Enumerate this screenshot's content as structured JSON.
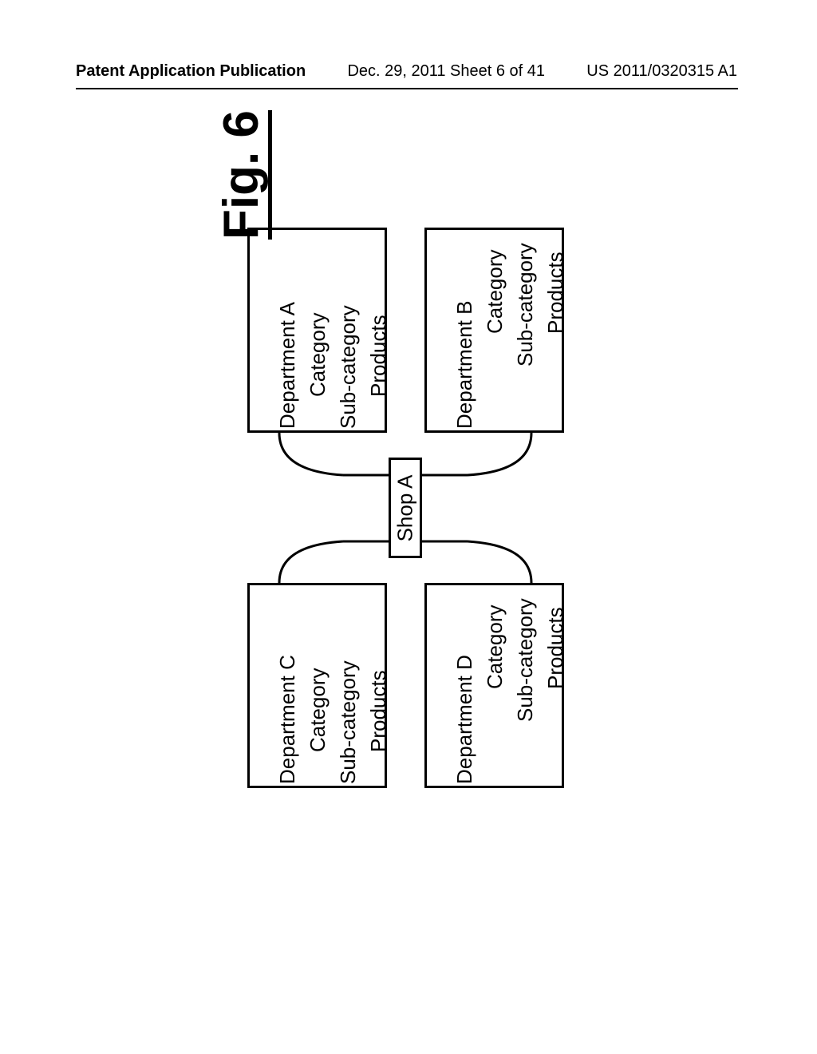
{
  "header": {
    "left": "Patent Application Publication",
    "center": "Dec. 29, 2011  Sheet 6 of 41",
    "right": "US 2011/0320315 A1"
  },
  "figure_label": "Fig. 6",
  "shop_label": "Shop A",
  "departments": {
    "a": {
      "title": "Department A",
      "l1": "Category",
      "l2": "Sub-category",
      "l3": "Products"
    },
    "b": {
      "title": "Department B",
      "l1": "Category",
      "l2": "Sub-category",
      "l3": "Products"
    },
    "c": {
      "title": "Department C",
      "l1": "Category",
      "l2": "Sub-category",
      "l3": "Products"
    },
    "d": {
      "title": "Department D",
      "l1": "Category",
      "l2": "Sub-category",
      "l3": "Products"
    }
  }
}
